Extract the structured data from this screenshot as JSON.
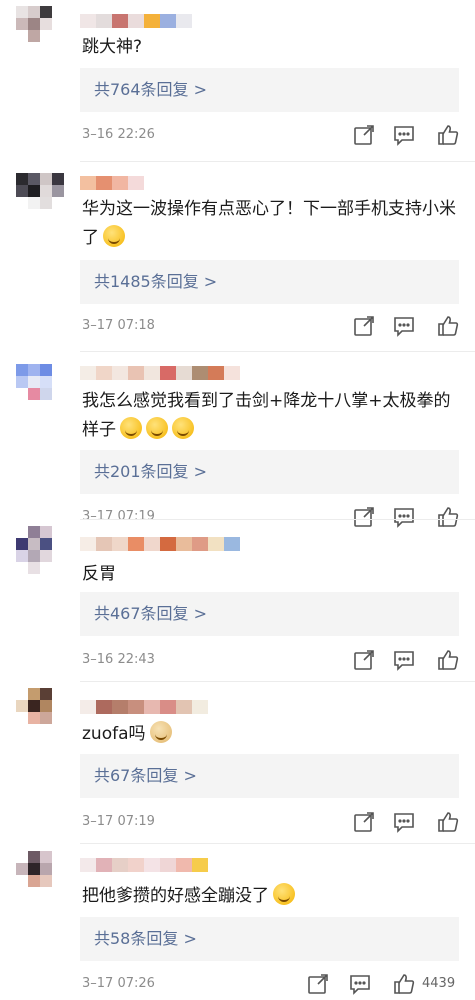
{
  "comments": [
    {
      "text": "跳大神?",
      "replies": "共764条回复 >",
      "time": "3–16 22:26",
      "like_count": ""
    },
    {
      "text": "华为这一波操作有点恶心了！下一部手机支持小米了",
      "replies": "共1485条回复 >",
      "time": "3–17 07:18",
      "like_count": ""
    },
    {
      "text": "我怎么感觉我看到了击剑+降龙十八掌+太极拳的样子",
      "replies": "共201条回复 >",
      "time": "3–17 07:19",
      "like_count": ""
    },
    {
      "text": "反胃",
      "replies": "共467条回复 >",
      "time": "3–16 22:43",
      "like_count": ""
    },
    {
      "text": "zuofa吗",
      "replies": "共67条回复 >",
      "time": "3–17 07:19",
      "like_count": ""
    },
    {
      "text": "把他爹攒的好感全蹦没了",
      "replies": "共58条回复 >",
      "time": "3–17 07:26",
      "like_count": "4439"
    }
  ],
  "icons": [
    "share-icon",
    "comment-icon",
    "like-icon",
    "emoji-icon"
  ],
  "colors": {
    "reply_link": "#5a6f96",
    "time": "#8c8c8c",
    "reply_bg": "#f4f4f4"
  }
}
